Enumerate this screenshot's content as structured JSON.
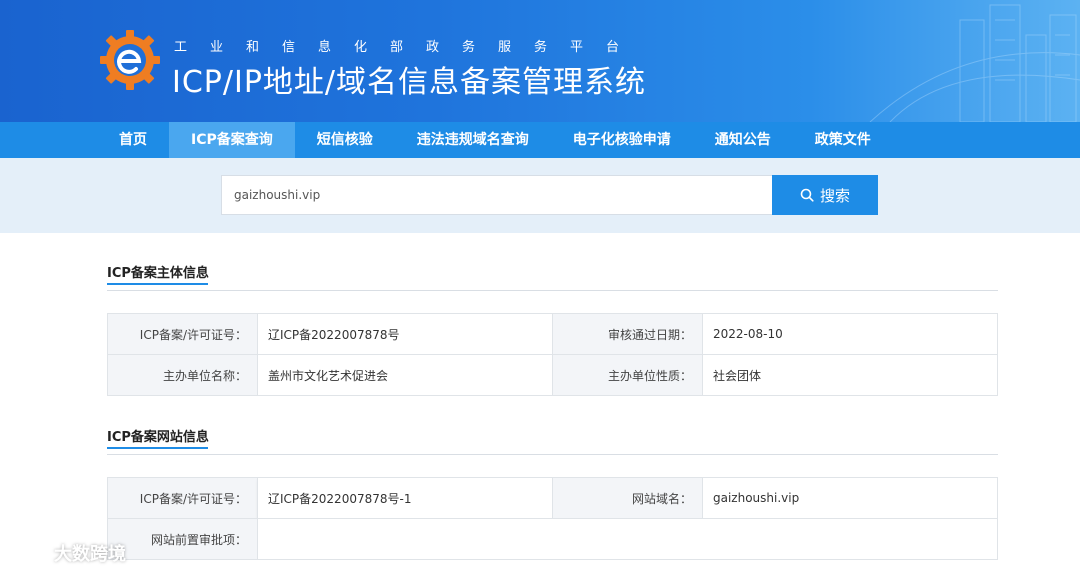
{
  "header": {
    "subtitle": "工业和信息化部政务服务平台",
    "title": "ICP/IP地址/域名信息备案管理系统"
  },
  "nav": {
    "items": [
      "首页",
      "ICP备案查询",
      "短信核验",
      "违法违规域名查询",
      "电子化核验申请",
      "通知公告",
      "政策文件"
    ],
    "active_index": 1
  },
  "search": {
    "value": "gaizhoushi.vip",
    "button_label": "搜索"
  },
  "subject_info": {
    "title": "ICP备案主体信息",
    "license_label": "ICP备案/许可证号：",
    "license_value": "辽ICP备2022007878号",
    "approval_date_label": "审核通过日期：",
    "approval_date_value": "2022-08-10",
    "org_name_label": "主办单位名称：",
    "org_name_value": "盖州市文化艺术促进会",
    "org_type_label": "主办单位性质：",
    "org_type_value": "社会团体"
  },
  "site_info": {
    "title": "ICP备案网站信息",
    "license_label": "ICP备案/许可证号：",
    "license_value": "辽ICP备2022007878号-1",
    "domain_label": "网站域名：",
    "domain_value": "gaizhoushi.vip",
    "preapproval_label": "网站前置审批项：",
    "preapproval_value": ""
  },
  "watermark": {
    "text": "大数跨境"
  },
  "colors": {
    "nav_bg": "#1e8ce6",
    "nav_active": "#4aa7ef",
    "accent": "#1e8ce6",
    "search_bg": "#e4eff9"
  }
}
